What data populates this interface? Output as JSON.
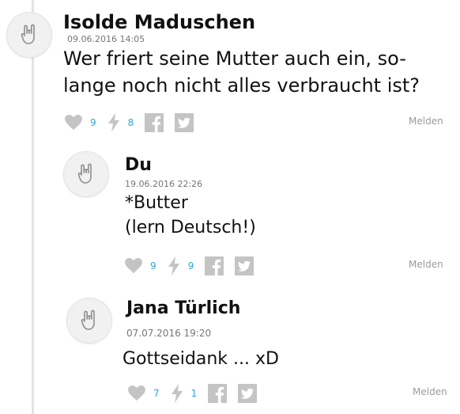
{
  "comments": [
    {
      "author": "Isolde Maduschen",
      "date": "09.06.2016 14:05",
      "text_lines": [
        "Wer friert seine Mutter auch ein, so-",
        "lange noch nicht alles verbraucht ist?"
      ],
      "likes": "9",
      "flashes": "8",
      "report": "Melden"
    },
    {
      "author": "Du",
      "date": "19.06.2016 22:26",
      "text_lines": [
        "*Butter",
        "(lern Deutsch!)"
      ],
      "likes": "9",
      "flashes": "9",
      "report": "Melden"
    },
    {
      "author": "Jana Türlich",
      "date": "07.07.2016 19:20",
      "text_lines": [
        "Gottseidank ... xD"
      ],
      "likes": "7",
      "flashes": "1",
      "report": "Melden"
    }
  ],
  "icons": {
    "avatar": "rock-hand-icon",
    "like": "heart-icon",
    "flash": "lightning-icon",
    "facebook": "facebook-icon",
    "twitter": "twitter-icon"
  },
  "colors": {
    "count": "#2ba6de",
    "icon_gray": "#c4c4c4",
    "muted": "#9a9a9a",
    "thread_line": "#e4e4e4"
  }
}
